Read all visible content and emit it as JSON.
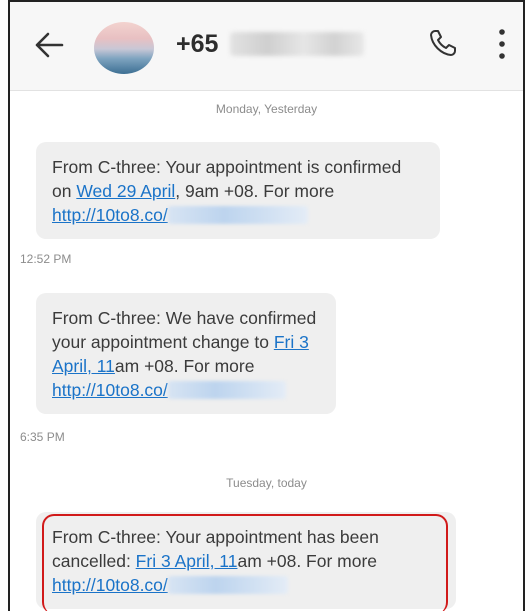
{
  "header": {
    "number_prefix": "+65",
    "icons": {
      "back": "arrow-left-icon",
      "call": "phone-icon",
      "more": "more-vertical-icon"
    }
  },
  "messages": [
    {
      "separator": "Monday, Yesterday",
      "text_a": "From C-three: Your appointment is confirmed on ",
      "link_date": "Wed 29 April",
      "text_b": ", 9am +08. For more ",
      "link_url": "http://10to8.co/",
      "time": "12:52 PM"
    },
    {
      "text_a": "From C-three: We have confirmed your appointment change to ",
      "link_date": "Fri 3 April, 11",
      "text_b": "am +08. For more ",
      "link_url": "http://10to8.co/",
      "time": "6:35 PM"
    },
    {
      "separator": "Tuesday, today",
      "text_a": "From C-three: Your appointment has been cancelled: ",
      "link_date": "Fri 3 April, 11",
      "text_b": "am +08. For more ",
      "link_url": "http://10to8.co/"
    }
  ],
  "colors": {
    "link": "#1a73c8",
    "highlight": "#d11a1a",
    "bubble": "#efefef"
  }
}
